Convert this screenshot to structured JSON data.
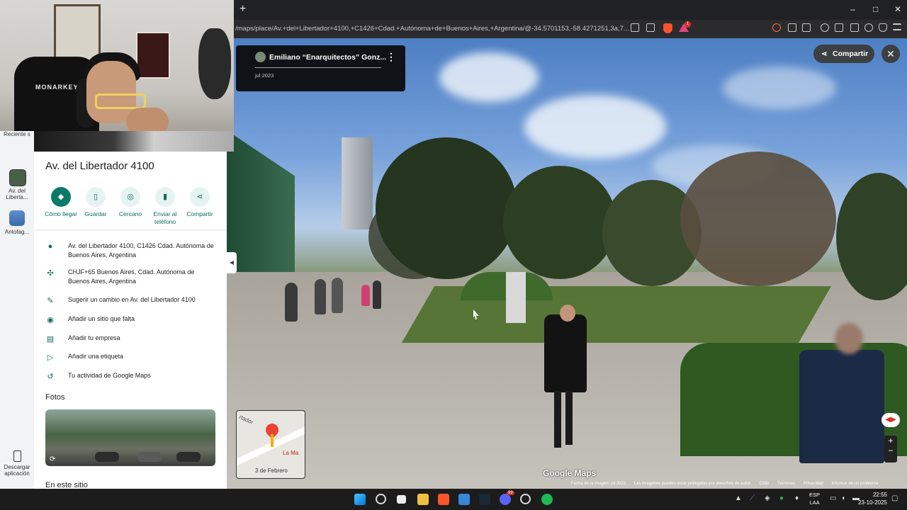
{
  "browser": {
    "new_tab": "+",
    "url": "/maps/place/Av.+del+Libertador+4100,+C1426+Cdad.+Autónoma+de+Buenos+Aires,+Argentina/@-34.5701153,-58.4271251,3a,7...",
    "window_controls": [
      "–",
      "□",
      "✕"
    ],
    "brave_badge": "1"
  },
  "streetview": {
    "author": "Emiliano “Enarquitectos” Gonz...",
    "date": "jul 2023",
    "share_label": "Compartir",
    "close_icon": "✕",
    "minimap": {
      "street": "rtador",
      "place": "La Ma",
      "caption": "3 de Febrero"
    },
    "watermark": "Google Maps",
    "legal": [
      "Fecha de la imagen: jul 2023",
      "Las imágenes pueden estar protegidas por derechos de autor.",
      "Chile",
      "Términos",
      "Privacidad",
      "Informar de un problema"
    ],
    "zoom_in": "+",
    "zoom_out": "−"
  },
  "rail": {
    "recent_label": "Reciente s",
    "item1": "Av. del Liberta...",
    "item2": "Antofag...",
    "download": "Descargar aplicación"
  },
  "webcam": {
    "chair_logo": "MONARKEY"
  },
  "panel": {
    "title": "Av. del Libertador 4100",
    "actions": [
      {
        "label": "Cómo llegar",
        "icon": "directions-icon"
      },
      {
        "label": "Guardar",
        "icon": "bookmark-icon"
      },
      {
        "label": "Cercano",
        "icon": "nearby-icon"
      },
      {
        "label": "Enviar al teléfono",
        "icon": "send-to-phone-icon"
      },
      {
        "label": "Compartir",
        "icon": "share-icon"
      }
    ],
    "rows": [
      "Av. del Libertador 4100, C1426 Cdad. Autónoma de Buenos Aires, Argentina",
      "CHJF+65 Buenos Aires, Cdad. Autónoma de Buenos Aires, Argentina",
      "Sugerir un cambio en Av. del Libertador 4100",
      "Añadir un sitio que falta",
      "Añadir tu empresa",
      "Añadir una etiqueta",
      "Tu actividad de Google Maps"
    ],
    "photos_label": "Fotos",
    "in_place_label": "En este sitio"
  },
  "taskbar": {
    "lang": "ESP",
    "lang2": "LAA",
    "time": "22:55",
    "date": "23-10-2025",
    "discord_badge": "99"
  },
  "colors": {
    "accent": "#0b7a68",
    "panel_bg": "#ffffff",
    "rail_bg": "#f1f3f4"
  }
}
